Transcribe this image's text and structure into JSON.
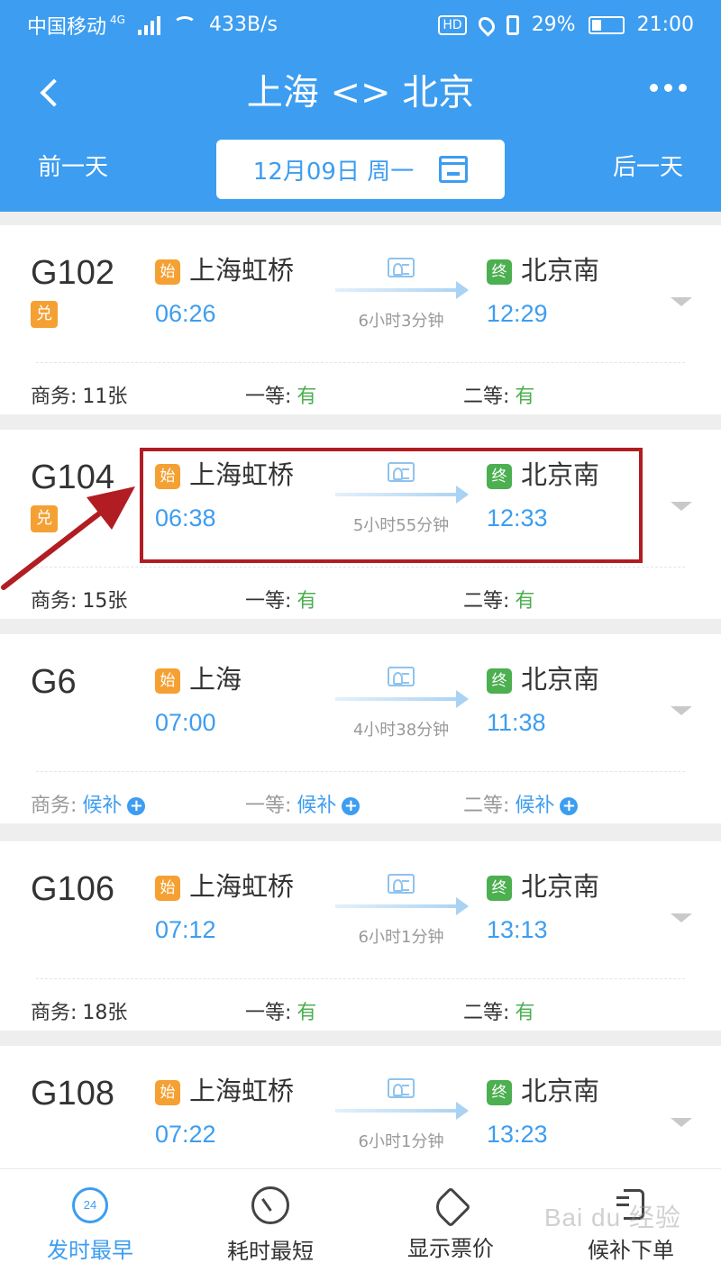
{
  "status_bar": {
    "carrier": "中国移动",
    "network": "4G",
    "speed": "433B/s",
    "hd": "HD",
    "battery": "29%",
    "time": "21:00"
  },
  "header": {
    "title": "上海 <> 北京",
    "prev_day": "前一天",
    "next_day": "后一天",
    "date": "12月09日 周一"
  },
  "trains": [
    {
      "no": "G102",
      "badge": "兑",
      "from_badge": "始",
      "from": "上海虹桥",
      "depart": "06:26",
      "duration": "6小时3分钟",
      "to_badge": "终",
      "to": "北京南",
      "arrive": "12:29",
      "seats": [
        {
          "label": "商务:",
          "value": "11张"
        },
        {
          "label": "一等:",
          "value": "有"
        },
        {
          "label": "二等:",
          "value": "有"
        }
      ]
    },
    {
      "no": "G104",
      "badge": "兑",
      "from_badge": "始",
      "from": "上海虹桥",
      "depart": "06:38",
      "duration": "5小时55分钟",
      "to_badge": "终",
      "to": "北京南",
      "arrive": "12:33",
      "seats": [
        {
          "label": "商务:",
          "value": "15张"
        },
        {
          "label": "一等:",
          "value": "有"
        },
        {
          "label": "二等:",
          "value": "有"
        }
      ]
    },
    {
      "no": "G6",
      "badge": "",
      "from_badge": "始",
      "from": "上海",
      "depart": "07:00",
      "duration": "4小时38分钟",
      "to_badge": "终",
      "to": "北京南",
      "arrive": "11:38",
      "seats": [
        {
          "label": "商务:",
          "value": "候补"
        },
        {
          "label": "一等:",
          "value": "候补"
        },
        {
          "label": "二等:",
          "value": "候补"
        }
      ]
    },
    {
      "no": "G106",
      "badge": "",
      "from_badge": "始",
      "from": "上海虹桥",
      "depart": "07:12",
      "duration": "6小时1分钟",
      "to_badge": "终",
      "to": "北京南",
      "arrive": "13:13",
      "seats": [
        {
          "label": "商务:",
          "value": "18张"
        },
        {
          "label": "一等:",
          "value": "有"
        },
        {
          "label": "二等:",
          "value": "有"
        }
      ]
    },
    {
      "no": "G108",
      "badge": "",
      "from_badge": "始",
      "from": "上海虹桥",
      "depart": "07:22",
      "duration": "6小时1分钟",
      "to_badge": "终",
      "to": "北京南",
      "arrive": "13:23"
    }
  ],
  "bottom_bar": [
    {
      "label": "发时最早",
      "icon_text": "24"
    },
    {
      "label": "耗时最短"
    },
    {
      "label": "显示票价"
    },
    {
      "label": "候补下单"
    }
  ],
  "watermark": "Bai du 经验",
  "colors": {
    "primary": "#3d9df0",
    "start_badge": "#f5a033",
    "end_badge": "#4caf50",
    "available": "#4caf50",
    "highlight_box": "#b11d22"
  },
  "icons": {
    "back": "back-arrow-icon",
    "more": "more-dots-icon",
    "calendar": "calendar-icon",
    "id_card": "id-card-icon",
    "expand": "chevron-down-icon",
    "waitlist_add": "plus-circle-icon"
  }
}
